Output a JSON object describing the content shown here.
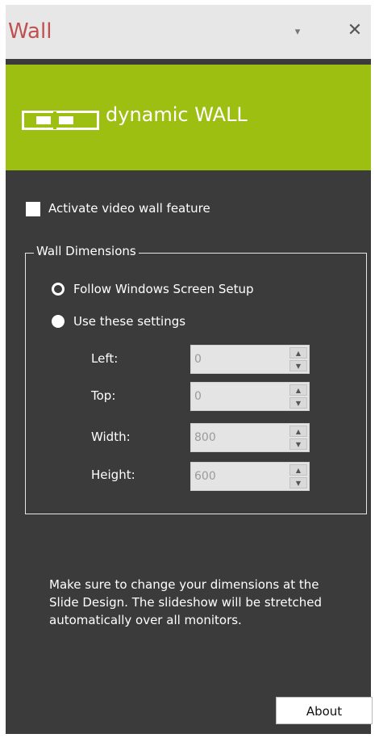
{
  "header": {
    "title": "Wall",
    "dropdown_glyph": "▾",
    "close_glyph": "✕"
  },
  "banner": {
    "brand": "dynamic WALL",
    "logo_icon": "dynamic-wall-logo-icon"
  },
  "options": {
    "activate_label": "Activate video wall feature",
    "activate_checked": false
  },
  "dimensions": {
    "legend": "Wall Dimensions",
    "follow_label": "Follow Windows Screen  Setup",
    "custom_label": "Use these settings",
    "selected": "custom",
    "fields": [
      {
        "label": "Left:",
        "value": "0"
      },
      {
        "label": "Top:",
        "value": "0"
      },
      {
        "label": "Width:",
        "value": "800"
      },
      {
        "label": "Height:",
        "value": "600"
      }
    ]
  },
  "note": "Make sure to change your dimensions at the Slide Design. The slideshow will be stretched automatically over all monitors.",
  "footer": {
    "about_label": "About"
  },
  "colors": {
    "title": "#c0504d",
    "banner": "#9dbf12",
    "pane": "#3b3b3b"
  }
}
